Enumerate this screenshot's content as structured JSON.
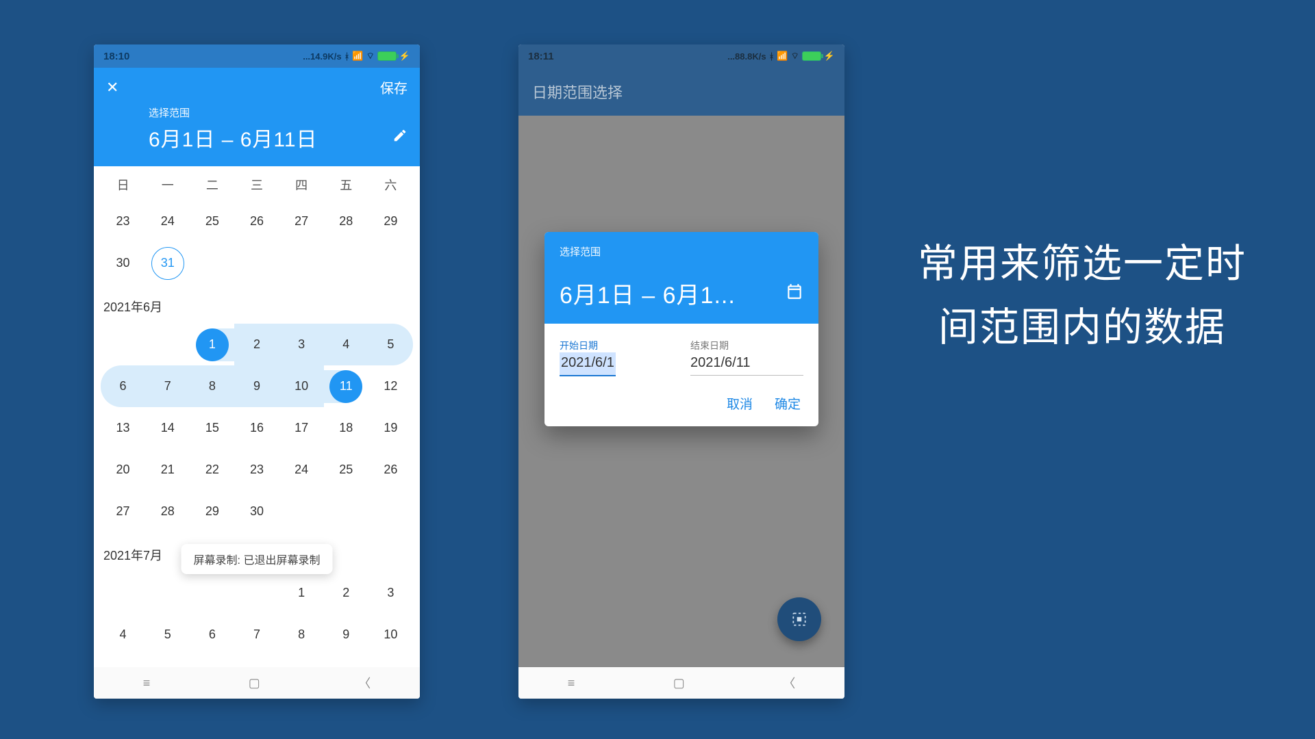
{
  "caption": "常用来筛选一定时间范围内的数据",
  "left": {
    "status": {
      "time": "18:10",
      "net": "...14.9K/s"
    },
    "appbar": {
      "close_icon": "close",
      "save_label": "保存",
      "subtitle": "选择范围",
      "range_text": "6月1日 – 6月11日",
      "edit_icon": "edit"
    },
    "week_head": [
      "日",
      "一",
      "二",
      "三",
      "四",
      "五",
      "六"
    ],
    "months": [
      {
        "label": "",
        "rows": [
          [
            "23",
            "24",
            "25",
            "26",
            "27",
            "28",
            "29"
          ],
          [
            "30",
            "31",
            "",
            "",
            "",
            "",
            ""
          ]
        ],
        "today": "31"
      },
      {
        "label": "2021年6月",
        "rows": [
          [
            "",
            "",
            "1",
            "2",
            "3",
            "4",
            "5"
          ],
          [
            "6",
            "7",
            "8",
            "9",
            "10",
            "11",
            "12"
          ],
          [
            "13",
            "14",
            "15",
            "16",
            "17",
            "18",
            "19"
          ],
          [
            "20",
            "21",
            "22",
            "23",
            "24",
            "25",
            "26"
          ],
          [
            "27",
            "28",
            "29",
            "30",
            "",
            "",
            ""
          ]
        ],
        "sel_start": "1",
        "sel_end": "11"
      },
      {
        "label": "2021年7月",
        "rows": [
          [
            "",
            "",
            "",
            "",
            "1",
            "2",
            "3"
          ],
          [
            "4",
            "5",
            "6",
            "7",
            "8",
            "9",
            "10"
          ]
        ]
      }
    ],
    "toast": "屏幕录制: 已退出屏幕录制"
  },
  "right": {
    "status": {
      "time": "18:11",
      "net": "...88.8K/s"
    },
    "appbar_title": "日期范围选择",
    "dialog": {
      "subtitle": "选择范围",
      "title": "6月1日 – 6月1...",
      "start_label": "开始日期",
      "start_value": "2021/6/1",
      "end_label": "结束日期",
      "end_value": "2021/6/11",
      "cancel": "取消",
      "confirm": "确定"
    }
  }
}
